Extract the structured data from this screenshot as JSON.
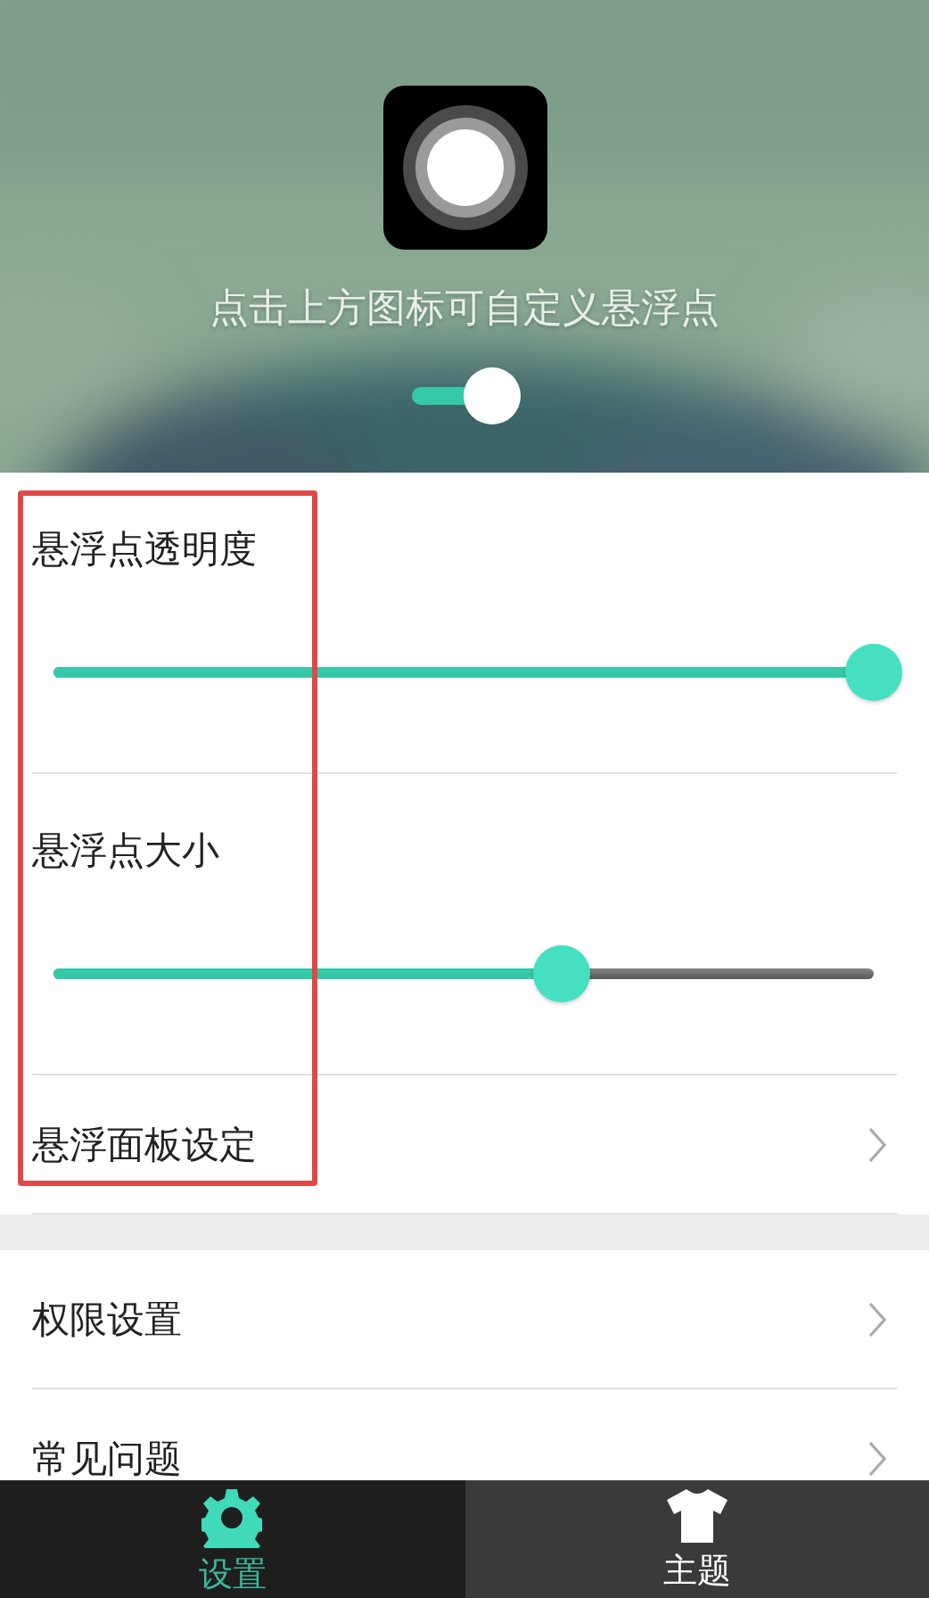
{
  "header": {
    "kind": "picture",
    "hint": "点击上方图标可自定义悬浮点",
    "toggle": {
      "on": true
    }
  },
  "groups": [
    {
      "items": [
        {
          "kind": "slider",
          "label": "悬浮点透明度",
          "level": 1.0
        },
        {
          "kind": "slider",
          "label": "悬浮点大小",
          "level": 0.62
        },
        {
          "kind": "link",
          "label": "悬浮面板设定"
        }
      ]
    },
    {
      "items": [
        {
          "kind": "link",
          "label": "权限设置"
        },
        {
          "kind": "link",
          "label": "常见问题"
        }
      ]
    }
  ],
  "tabs": [
    {
      "label": "设置",
      "kind": "gear",
      "selected": true
    },
    {
      "label": "主题",
      "kind": "shirt",
      "selected": false
    }
  ]
}
